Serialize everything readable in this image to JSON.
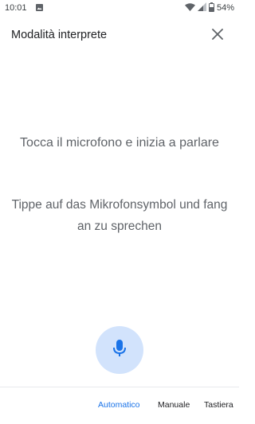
{
  "status_bar": {
    "time": "10:01",
    "battery": "54%"
  },
  "header": {
    "title": "Modalità interprete",
    "close_icon": "close-icon"
  },
  "prompts": {
    "primary": "Tocca il microfono e inizia a parlare",
    "secondary": "Tippe auf das Mikrofonsymbol und fang an zu sprechen"
  },
  "mic": {
    "icon": "microphone-icon",
    "background_color": "#d2e3fc",
    "icon_color": "#1a73e8"
  },
  "mode_tabs": [
    {
      "label": "Automatico",
      "active": true
    },
    {
      "label": "Manuale",
      "active": false
    },
    {
      "label": "Tastiera",
      "active": false
    }
  ],
  "colors": {
    "accent": "#1a73e8",
    "prompt_text": "#5f6368"
  }
}
